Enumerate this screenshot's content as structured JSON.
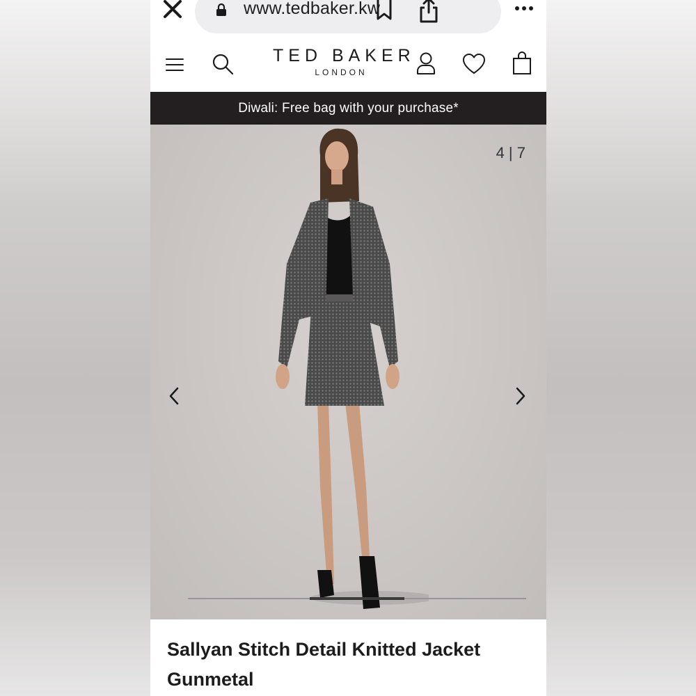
{
  "browser": {
    "url": "www.tedbaker.kw",
    "icons": [
      "close-icon",
      "lock-icon",
      "bookmark-icon",
      "share-icon",
      "more-icon"
    ]
  },
  "header": {
    "logo_main": "TED BAKER",
    "logo_sub": "LONDON",
    "icons": [
      "menu-icon",
      "search-icon",
      "account-icon",
      "heart-icon",
      "bag-icon"
    ]
  },
  "promo": {
    "text": "Diwali: Free bag with your purchase*"
  },
  "gallery": {
    "counter": "4 | 7",
    "current": 4,
    "total": 7,
    "progress_fraction": 0.28
  },
  "product": {
    "title": "Sallyan Stitch Detail Knitted Jacket Gunmetal"
  },
  "colors": {
    "promo_bg": "#231f20",
    "text": "#1c1c1c",
    "url_pill": "#eeeef0"
  }
}
